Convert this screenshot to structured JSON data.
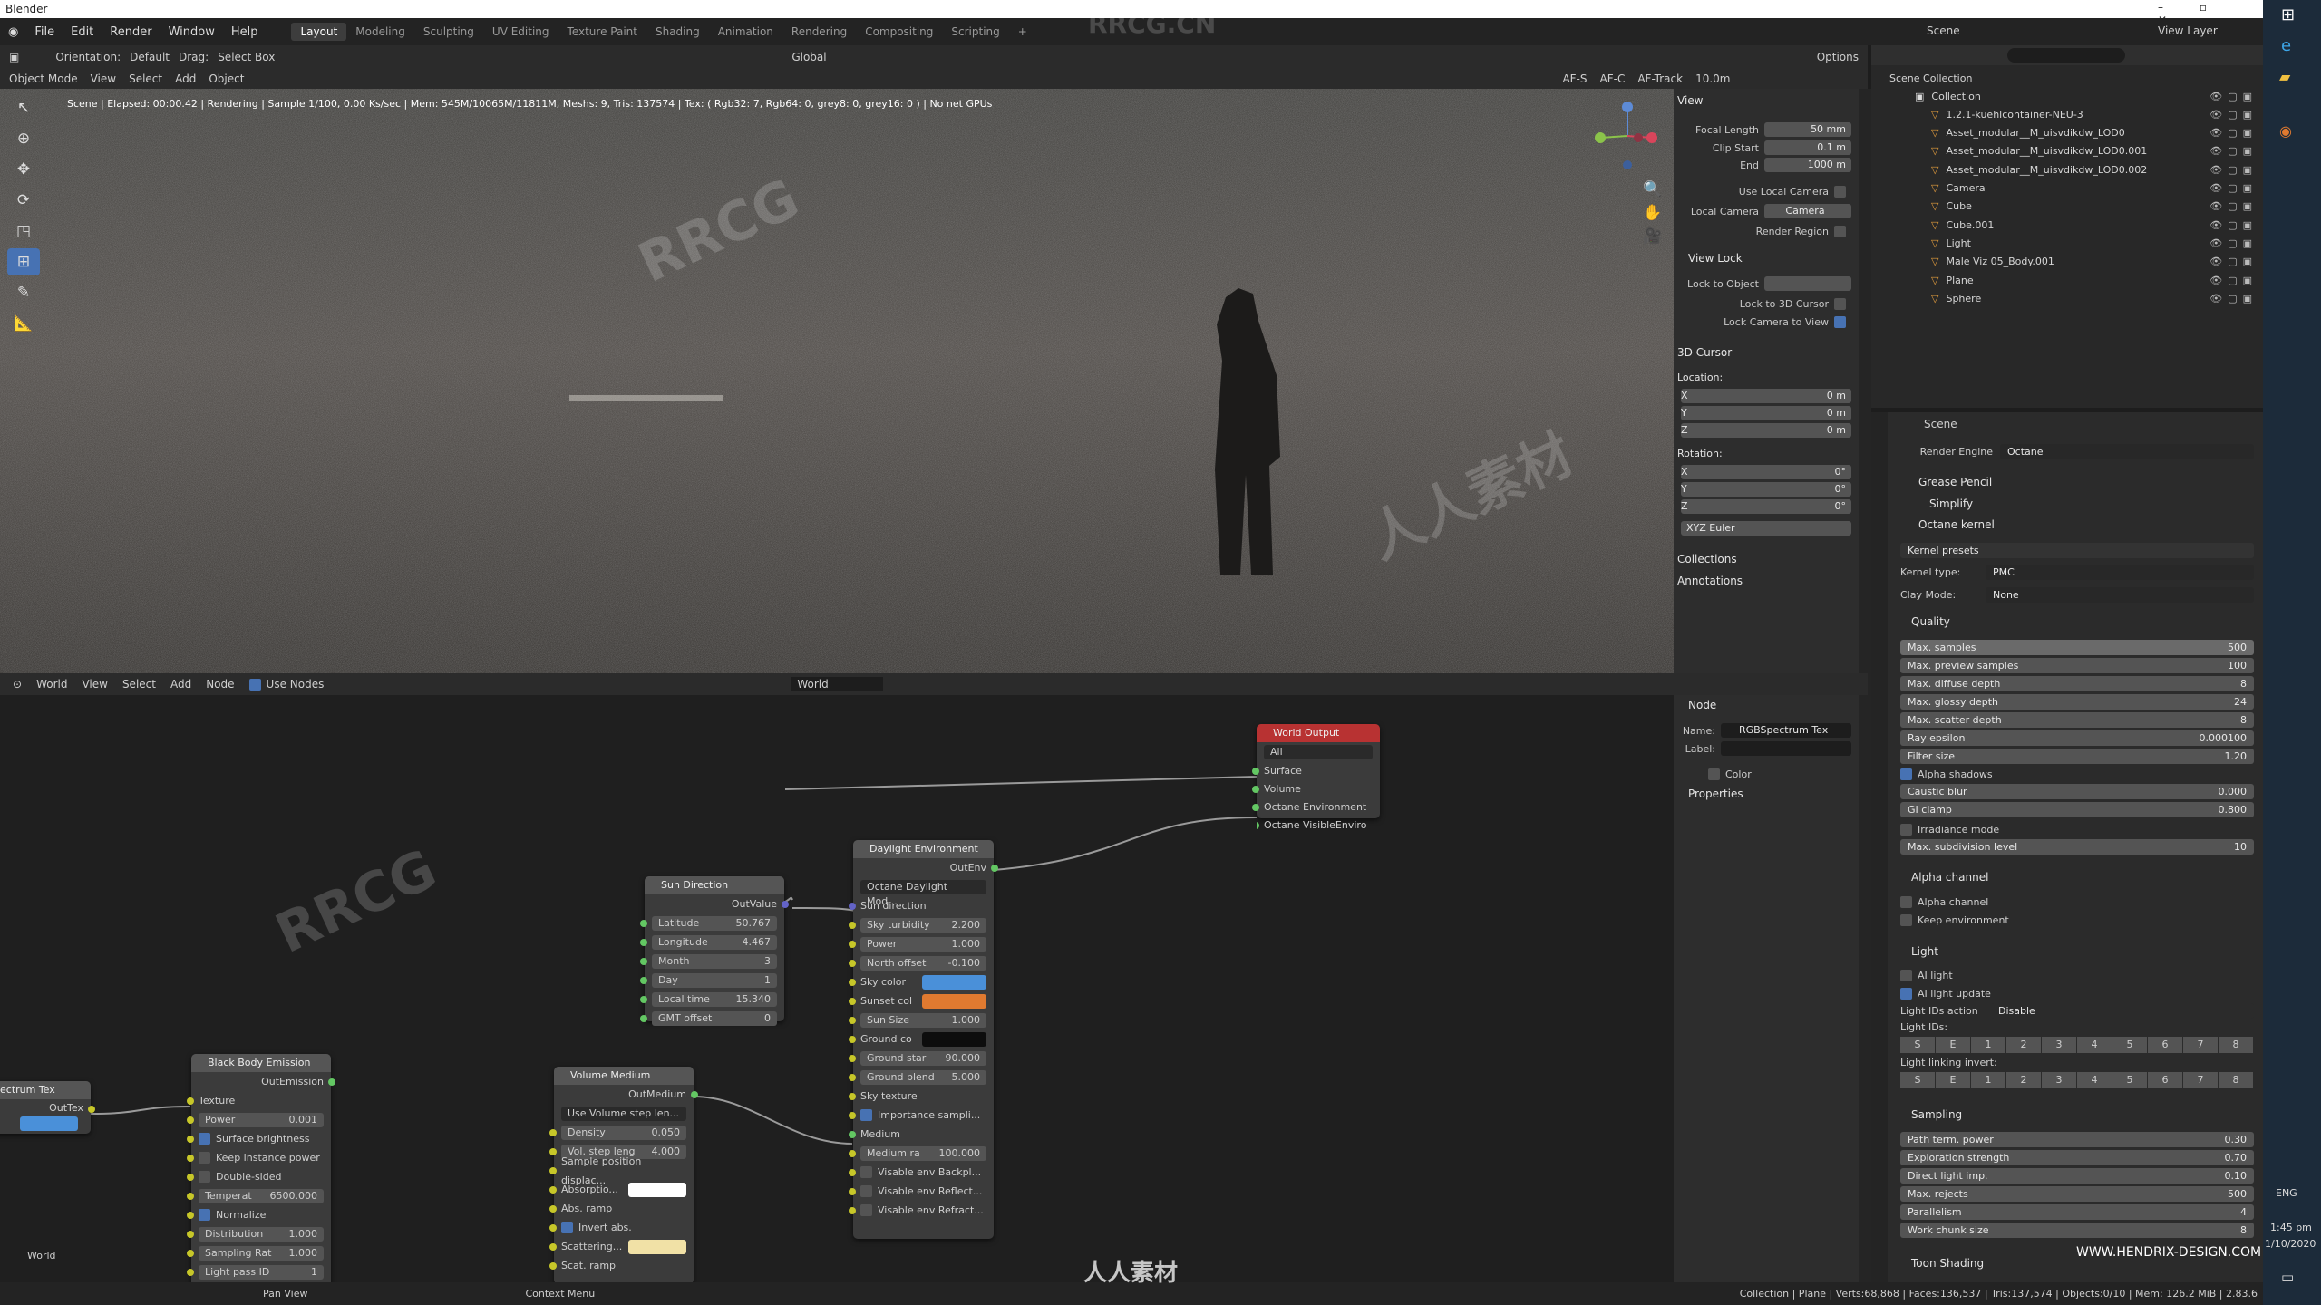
{
  "app": {
    "title": "Blender"
  },
  "menu": {
    "items": [
      "File",
      "Edit",
      "Render",
      "Window",
      "Help"
    ],
    "workspaces": [
      "Layout",
      "Modeling",
      "Sculpting",
      "UV Editing",
      "Texture Paint",
      "Shading",
      "Animation",
      "Rendering",
      "Compositing",
      "Scripting"
    ]
  },
  "toolbar": {
    "orientation_label": "Orientation:",
    "orientation_value": "Default",
    "drag_label": "Drag:",
    "drag_value": "Select Box",
    "transform": "Global",
    "options": "Options"
  },
  "viewport_header": {
    "mode": "Object Mode",
    "items": [
      "View",
      "Select",
      "Add",
      "Object"
    ],
    "afs": "AF-S",
    "afc": "AF-C",
    "af_track": "AF-Track",
    "focus": "10.0m"
  },
  "render_status": "Scene | Elapsed: 00:00.42 | Rendering | Sample 1/100, 0.00 Ks/sec | Mem: 545M/10065M/11811M, Meshs: 9, Tris: 137574 | Tex: ( Rgb32: 7, Rgb64: 0, grey8: 0, grey16: 0 ) | No net GPUs",
  "view_panel": {
    "view": "View",
    "focal_length_label": "Focal Length",
    "focal_length": "50 mm",
    "clip_start_label": "Clip Start",
    "clip_start": "0.1 m",
    "end_label": "End",
    "end": "1000 m",
    "use_local_camera": "Use Local Camera",
    "local_camera_label": "Local Camera",
    "local_camera": "Camera",
    "render_region": "Render Region",
    "view_lock": "View Lock",
    "lock_to_object": "Lock to Object",
    "lock_3d_cursor": "Lock to 3D Cursor",
    "lock_camera": "Lock Camera to View",
    "cursor": "3D Cursor",
    "location": "Location:",
    "rotation": "Rotation:",
    "loc": [
      {
        "axis": "X",
        "v": "0 m"
      },
      {
        "axis": "Y",
        "v": "0 m"
      },
      {
        "axis": "Z",
        "v": "0 m"
      }
    ],
    "rot": [
      {
        "axis": "X",
        "v": "0°"
      },
      {
        "axis": "Y",
        "v": "0°"
      },
      {
        "axis": "Z",
        "v": "0°"
      }
    ],
    "euler": "XYZ Euler",
    "collections": "Collections",
    "annotations": "Annotations"
  },
  "outliner": {
    "scene": "Scene",
    "view_layer": "View Layer",
    "root": "Scene Collection",
    "items": [
      "Collection",
      "1.2.1-kuehlcontainer-NEU-3",
      "Asset_modular__M_uisvdikdw_LOD0",
      "Asset_modular__M_uisvdikdw_LOD0.001",
      "Asset_modular__M_uisvdikdw_LOD0.002",
      "Camera",
      "Cube",
      "Cube.001",
      "Light",
      "Male Viz 05_Body.001",
      "Plane",
      "Sphere"
    ]
  },
  "properties": {
    "scene": "Scene",
    "render_engine_label": "Render Engine",
    "render_engine": "Octane",
    "grease_pencil": "Grease Pencil",
    "simplify": "Simplify",
    "octane_kernel": "Octane kernel",
    "kernel_presets": "Kernel presets",
    "kernel_type_label": "Kernel type:",
    "kernel_type": "PMC",
    "clay_mode_label": "Clay Mode:",
    "clay_mode": "None",
    "quality": "Quality",
    "quality_rows": [
      {
        "k": "Max. samples",
        "v": "500"
      },
      {
        "k": "Max. preview samples",
        "v": "100"
      },
      {
        "k": "Max. diffuse depth",
        "v": "8"
      },
      {
        "k": "Max. glossy depth",
        "v": "24"
      },
      {
        "k": "Max. scatter depth",
        "v": "8"
      },
      {
        "k": "Ray epsilon",
        "v": "0.000100"
      },
      {
        "k": "Filter size",
        "v": "1.20"
      }
    ],
    "alpha_shadows": "Alpha shadows",
    "quality_rows2": [
      {
        "k": "Caustic blur",
        "v": "0.000"
      },
      {
        "k": "GI clamp",
        "v": "0.800"
      }
    ],
    "irradiance": "Irradiance mode",
    "max_subdiv_label": "Max. subdivision level",
    "max_subdiv": "10",
    "alpha_channel_head": "Alpha channel",
    "alpha_channel": "Alpha channel",
    "keep_env": "Keep environment",
    "light_head": "Light",
    "ai_light": "AI light",
    "ai_light_update": "AI light update",
    "light_ids_action_label": "Light IDs action",
    "light_ids_action": "Disable",
    "light_ids": "Light IDs:",
    "light_linking": "Light linking invert:",
    "id_buttons": [
      "S",
      "E",
      "1",
      "2",
      "3",
      "4",
      "5",
      "6",
      "7",
      "8"
    ],
    "sampling": "Sampling",
    "sampling_rows": [
      {
        "k": "Path term. power",
        "v": "0.30"
      },
      {
        "k": "Exploration strength",
        "v": "0.70"
      },
      {
        "k": "Direct light imp.",
        "v": "0.10"
      },
      {
        "k": "Max. rejects",
        "v": "500"
      },
      {
        "k": "Parallelism",
        "v": "4"
      },
      {
        "k": "Work chunk size",
        "v": "8"
      }
    ],
    "toon": "Toon Shading"
  },
  "node_header": {
    "editor": "World",
    "items": [
      "View",
      "Select",
      "Add",
      "Node"
    ],
    "use_nodes": "Use Nodes",
    "world": "World"
  },
  "node_panel": {
    "node": "Node",
    "name_label": "Name:",
    "name": "RGBSpectrum Tex",
    "label_label": "Label:",
    "color": "Color",
    "properties": "Properties"
  },
  "nodes": {
    "world_output": {
      "title": "World Output",
      "target": "All",
      "inputs": [
        "Surface",
        "Volume",
        "Octane Environment",
        "Octane VisibleEnviro"
      ]
    },
    "daylight": {
      "title": "Daylight Environment",
      "out": "OutEnv",
      "model": "Octane Daylight Mod...",
      "sun_dir": "Sun direction",
      "rows": [
        {
          "k": "Sky turbidity",
          "v": "2.200"
        },
        {
          "k": "Power",
          "v": "1.000"
        },
        {
          "k": "North offset",
          "v": "-0.100"
        }
      ],
      "sky_color": "Sky color",
      "sunset": "Sunset col",
      "sun_size": "Sun Size",
      "sun_size_v": "1.000",
      "ground": "Ground co",
      "rows2": [
        {
          "k": "Ground star",
          "v": "90.000"
        },
        {
          "k": "Ground blend",
          "v": "5.000"
        }
      ],
      "sky_texture": "Sky texture",
      "importance": "Importance sampli...",
      "medium": "Medium",
      "medium_rad": "Medium ra",
      "medium_rad_v": "100.000",
      "visable": [
        "Visable env Backpl...",
        "Visable env Reflect...",
        "Visable env Refract..."
      ],
      "sky_hex": "#4a90d9",
      "sunset_hex": "#e07a30"
    },
    "sun_dir": {
      "title": "Sun Direction",
      "out": "OutValue",
      "rows": [
        {
          "k": "Latitude",
          "v": "50.767"
        },
        {
          "k": "Longitude",
          "v": "4.467"
        },
        {
          "k": "Month",
          "v": "3"
        },
        {
          "k": "Day",
          "v": "1"
        },
        {
          "k": "Local time",
          "v": "15.340"
        },
        {
          "k": "GMT offset",
          "v": "0"
        }
      ]
    },
    "volume": {
      "title": "Volume Medium",
      "out": "OutMedium",
      "mode": "Use Volume step len...",
      "rows": [
        {
          "k": "Density",
          "v": "0.050"
        },
        {
          "k": "Vol. step leng",
          "v": "4.000"
        }
      ],
      "sample_pos": "Sample position displac...",
      "absorption": "Absorptio...",
      "abs_ramp": "Abs. ramp",
      "invert": "Invert abs.",
      "scattering": "Scattering...",
      "scat_ramp": "Scat. ramp"
    },
    "blackbody": {
      "title": "Black Body Emission",
      "out": "OutEmission",
      "texture": "Texture",
      "power": {
        "k": "Power",
        "v": "0.001"
      },
      "surface_brightness": "Surface brightness",
      "keep_power": "Keep instance power",
      "double_sided": "Double-sided",
      "temp": {
        "k": "Temperat",
        "v": "6500.000"
      },
      "normalize": "Normalize",
      "rows": [
        {
          "k": "Distribution",
          "v": "1.000"
        },
        {
          "k": "Sampling Rat",
          "v": "1.000"
        },
        {
          "k": "Light pass ID",
          "v": "1"
        }
      ]
    },
    "spectrum": {
      "title": "ectrum Tex",
      "out": "OutTex"
    }
  },
  "node_editor_label": "World",
  "statusbar": {
    "pan": "Pan View",
    "context": "Context Menu",
    "info": "Collection | Plane | Verts:68,868 | Faces:136,537 | Tris:137,574 | Objects:0/10 | Mem: 126.2 MiB | 2.83.6"
  },
  "taskbar": {
    "time": "1:45 pm",
    "date": "1/10/2020",
    "lang": "ENG"
  },
  "watermark": {
    "site": "WWW.HENDRIX-DESIGN.COM",
    "logo": "人人素材",
    "rrcg": "RRCG",
    "rrcg_cn": "RRCG.CN"
  }
}
